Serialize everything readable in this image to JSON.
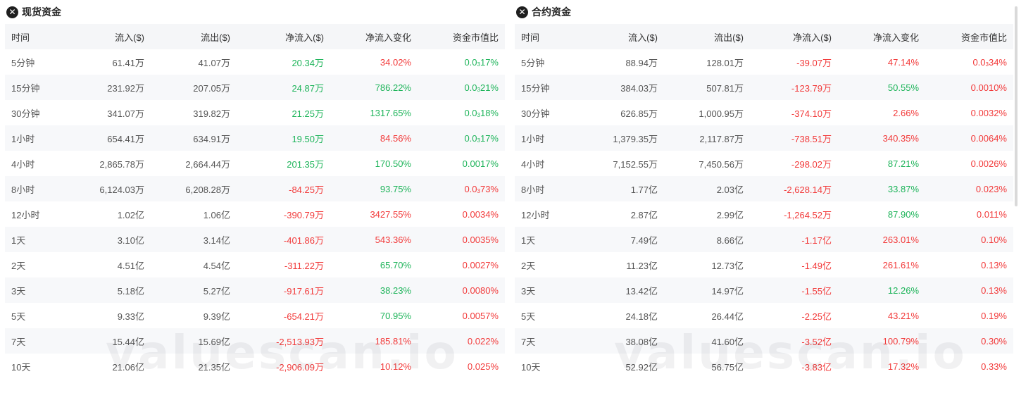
{
  "colors": {
    "positive": "#1eb45a",
    "negative": "#f23a3a",
    "header_bg": "#f5f6f8",
    "stripe_bg": "#f7f8fa"
  },
  "watermark": "valuescan.io",
  "columns": [
    "时间",
    "流入($)",
    "流出($)",
    "净流入($)",
    "净流入变化",
    "资金市值比"
  ],
  "spot": {
    "title": "现货资金",
    "icon": "close-circle-icon",
    "rows": [
      {
        "time": "5分钟",
        "inflow": "61.41万",
        "outflow": "41.07万",
        "net": "20.34万",
        "net_dir": "pos",
        "change": "34.02%",
        "change_dir": "neg",
        "ratio": "0.0₃17%",
        "ratio_dir": "pos"
      },
      {
        "time": "15分钟",
        "inflow": "231.92万",
        "outflow": "207.05万",
        "net": "24.87万",
        "net_dir": "pos",
        "change": "786.22%",
        "change_dir": "pos",
        "ratio": "0.0₃21%",
        "ratio_dir": "pos"
      },
      {
        "time": "30分钟",
        "inflow": "341.07万",
        "outflow": "319.82万",
        "net": "21.25万",
        "net_dir": "pos",
        "change": "1317.65%",
        "change_dir": "pos",
        "ratio": "0.0₃18%",
        "ratio_dir": "pos"
      },
      {
        "time": "1小时",
        "inflow": "654.41万",
        "outflow": "634.91万",
        "net": "19.50万",
        "net_dir": "pos",
        "change": "84.56%",
        "change_dir": "neg",
        "ratio": "0.0₃17%",
        "ratio_dir": "pos"
      },
      {
        "time": "4小时",
        "inflow": "2,865.78万",
        "outflow": "2,664.44万",
        "net": "201.35万",
        "net_dir": "pos",
        "change": "170.50%",
        "change_dir": "pos",
        "ratio": "0.0017%",
        "ratio_dir": "pos"
      },
      {
        "time": "8小时",
        "inflow": "6,124.03万",
        "outflow": "6,208.28万",
        "net": "-84.25万",
        "net_dir": "neg",
        "change": "93.75%",
        "change_dir": "pos",
        "ratio": "0.0₃73%",
        "ratio_dir": "neg"
      },
      {
        "time": "12小时",
        "inflow": "1.02亿",
        "outflow": "1.06亿",
        "net": "-390.79万",
        "net_dir": "neg",
        "change": "3427.55%",
        "change_dir": "neg",
        "ratio": "0.0034%",
        "ratio_dir": "neg"
      },
      {
        "time": "1天",
        "inflow": "3.10亿",
        "outflow": "3.14亿",
        "net": "-401.86万",
        "net_dir": "neg",
        "change": "543.36%",
        "change_dir": "neg",
        "ratio": "0.0035%",
        "ratio_dir": "neg"
      },
      {
        "time": "2天",
        "inflow": "4.51亿",
        "outflow": "4.54亿",
        "net": "-311.22万",
        "net_dir": "neg",
        "change": "65.70%",
        "change_dir": "pos",
        "ratio": "0.0027%",
        "ratio_dir": "neg"
      },
      {
        "time": "3天",
        "inflow": "5.18亿",
        "outflow": "5.27亿",
        "net": "-917.61万",
        "net_dir": "neg",
        "change": "38.23%",
        "change_dir": "pos",
        "ratio": "0.0080%",
        "ratio_dir": "neg"
      },
      {
        "time": "5天",
        "inflow": "9.33亿",
        "outflow": "9.39亿",
        "net": "-654.21万",
        "net_dir": "neg",
        "change": "70.95%",
        "change_dir": "pos",
        "ratio": "0.0057%",
        "ratio_dir": "neg"
      },
      {
        "time": "7天",
        "inflow": "15.44亿",
        "outflow": "15.69亿",
        "net": "-2,513.93万",
        "net_dir": "neg",
        "change": "185.81%",
        "change_dir": "neg",
        "ratio": "0.022%",
        "ratio_dir": "neg"
      },
      {
        "time": "10天",
        "inflow": "21.06亿",
        "outflow": "21.35亿",
        "net": "-2,906.09万",
        "net_dir": "neg",
        "change": "10.12%",
        "change_dir": "neg",
        "ratio": "0.025%",
        "ratio_dir": "neg"
      }
    ]
  },
  "futures": {
    "title": "合约资金",
    "icon": "close-circle-icon",
    "rows": [
      {
        "time": "5分钟",
        "inflow": "88.94万",
        "outflow": "128.01万",
        "net": "-39.07万",
        "net_dir": "neg",
        "change": "47.14%",
        "change_dir": "neg",
        "ratio": "0.0₃34%",
        "ratio_dir": "neg"
      },
      {
        "time": "15分钟",
        "inflow": "384.03万",
        "outflow": "507.81万",
        "net": "-123.79万",
        "net_dir": "neg",
        "change": "50.55%",
        "change_dir": "pos",
        "ratio": "0.0010%",
        "ratio_dir": "neg"
      },
      {
        "time": "30分钟",
        "inflow": "626.85万",
        "outflow": "1,000.95万",
        "net": "-374.10万",
        "net_dir": "neg",
        "change": "2.66%",
        "change_dir": "neg",
        "ratio": "0.0032%",
        "ratio_dir": "neg"
      },
      {
        "time": "1小时",
        "inflow": "1,379.35万",
        "outflow": "2,117.87万",
        "net": "-738.51万",
        "net_dir": "neg",
        "change": "340.35%",
        "change_dir": "neg",
        "ratio": "0.0064%",
        "ratio_dir": "neg"
      },
      {
        "time": "4小时",
        "inflow": "7,152.55万",
        "outflow": "7,450.56万",
        "net": "-298.02万",
        "net_dir": "neg",
        "change": "87.21%",
        "change_dir": "pos",
        "ratio": "0.0026%",
        "ratio_dir": "neg"
      },
      {
        "time": "8小时",
        "inflow": "1.77亿",
        "outflow": "2.03亿",
        "net": "-2,628.14万",
        "net_dir": "neg",
        "change": "33.87%",
        "change_dir": "pos",
        "ratio": "0.023%",
        "ratio_dir": "neg"
      },
      {
        "time": "12小时",
        "inflow": "2.87亿",
        "outflow": "2.99亿",
        "net": "-1,264.52万",
        "net_dir": "neg",
        "change": "87.90%",
        "change_dir": "pos",
        "ratio": "0.011%",
        "ratio_dir": "neg"
      },
      {
        "time": "1天",
        "inflow": "7.49亿",
        "outflow": "8.66亿",
        "net": "-1.17亿",
        "net_dir": "neg",
        "change": "263.01%",
        "change_dir": "neg",
        "ratio": "0.10%",
        "ratio_dir": "neg"
      },
      {
        "time": "2天",
        "inflow": "11.23亿",
        "outflow": "12.73亿",
        "net": "-1.49亿",
        "net_dir": "neg",
        "change": "261.61%",
        "change_dir": "neg",
        "ratio": "0.13%",
        "ratio_dir": "neg"
      },
      {
        "time": "3天",
        "inflow": "13.42亿",
        "outflow": "14.97亿",
        "net": "-1.55亿",
        "net_dir": "neg",
        "change": "12.26%",
        "change_dir": "pos",
        "ratio": "0.13%",
        "ratio_dir": "neg"
      },
      {
        "time": "5天",
        "inflow": "24.18亿",
        "outflow": "26.44亿",
        "net": "-2.25亿",
        "net_dir": "neg",
        "change": "43.21%",
        "change_dir": "neg",
        "ratio": "0.19%",
        "ratio_dir": "neg"
      },
      {
        "time": "7天",
        "inflow": "38.08亿",
        "outflow": "41.60亿",
        "net": "-3.52亿",
        "net_dir": "neg",
        "change": "100.79%",
        "change_dir": "neg",
        "ratio": "0.30%",
        "ratio_dir": "neg"
      },
      {
        "time": "10天",
        "inflow": "52.92亿",
        "outflow": "56.75亿",
        "net": "-3.83亿",
        "net_dir": "neg",
        "change": "17.32%",
        "change_dir": "neg",
        "ratio": "0.33%",
        "ratio_dir": "neg"
      }
    ]
  }
}
